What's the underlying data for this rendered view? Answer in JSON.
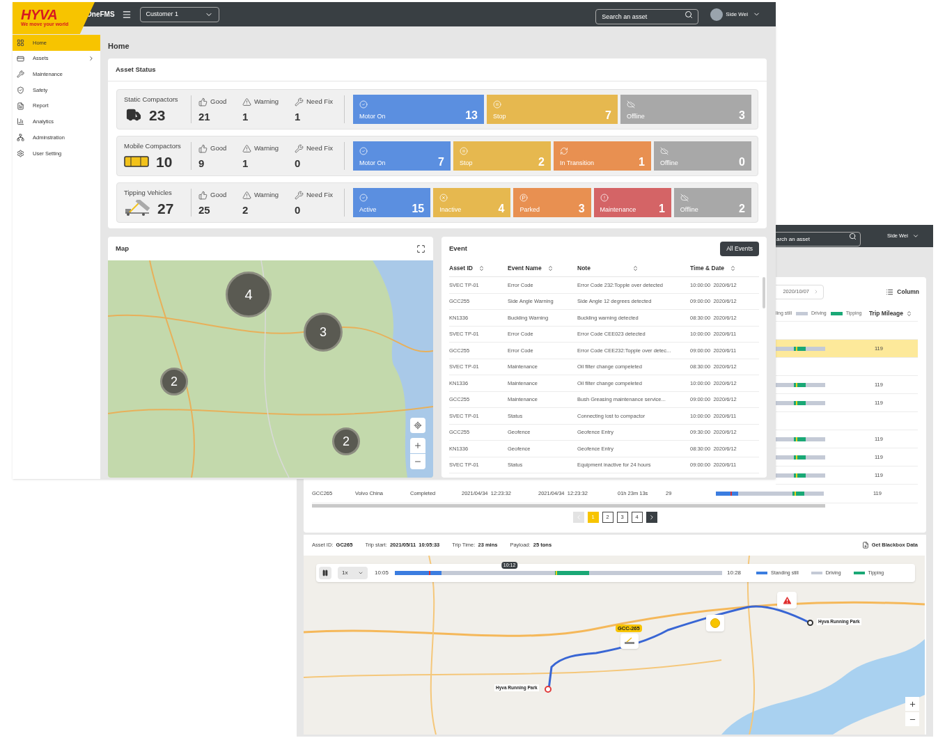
{
  "front": {
    "logo": {
      "brand": "HYVA",
      "tagline": "We move your world"
    },
    "header": {
      "app_name": "OneFMS",
      "customer_select": "Customer 1",
      "search_placeholder": "Search an asset",
      "user_name": "Side Wei"
    },
    "sidebar": {
      "items": [
        {
          "label": "Home",
          "selected": true,
          "has_submenu": false
        },
        {
          "label": "Assets",
          "selected": false,
          "has_submenu": true
        },
        {
          "label": "Maintenance",
          "selected": false,
          "has_submenu": false
        },
        {
          "label": "Safety",
          "selected": false,
          "has_submenu": false
        },
        {
          "label": "Report",
          "selected": false,
          "has_submenu": false
        },
        {
          "label": "Analytics",
          "selected": false,
          "has_submenu": false
        },
        {
          "label": "Adminstration",
          "selected": false,
          "has_submenu": false
        },
        {
          "label": "User Setting",
          "selected": false,
          "has_submenu": false
        }
      ]
    },
    "page_title": "Home",
    "asset_status": {
      "title": "Asset Status",
      "groups": [
        {
          "kind": "static",
          "name": "Static Compactors",
          "total": "23",
          "stats": [
            {
              "kind": "good",
              "label": "Good",
              "value": "21"
            },
            {
              "kind": "warning",
              "label": "Warning",
              "value": "1"
            },
            {
              "kind": "need_fix",
              "label": "Need Fix",
              "value": "1"
            }
          ],
          "tiles": [
            {
              "kind": "motor_on",
              "label": "Motor On",
              "count": "13"
            },
            {
              "kind": "stop",
              "label": "Stop",
              "count": "7"
            },
            {
              "kind": "offline",
              "label": "Offline",
              "count": "3"
            }
          ]
        },
        {
          "kind": "mobile",
          "name": "Mobile Compactors",
          "total": "10",
          "stats": [
            {
              "kind": "good",
              "label": "Good",
              "value": "9"
            },
            {
              "kind": "warning",
              "label": "Warning",
              "value": "1"
            },
            {
              "kind": "need_fix",
              "label": "Need Fix",
              "value": "0"
            }
          ],
          "tiles": [
            {
              "kind": "motor_on",
              "label": "Motor On",
              "count": "7"
            },
            {
              "kind": "stop",
              "label": "Stop",
              "count": "2"
            },
            {
              "kind": "transition",
              "label": "In Transition",
              "count": "1"
            },
            {
              "kind": "offline",
              "label": "Offline",
              "count": "0"
            }
          ]
        },
        {
          "kind": "tipping",
          "name": "Tipping Vehicles",
          "total": "27",
          "stats": [
            {
              "kind": "good",
              "label": "Good",
              "value": "25"
            },
            {
              "kind": "warning",
              "label": "Warning",
              "value": "2"
            },
            {
              "kind": "need_fix",
              "label": "Need Fix",
              "value": "0"
            }
          ],
          "tiles": [
            {
              "kind": "active",
              "label": "Active",
              "count": "15"
            },
            {
              "kind": "inactive",
              "label": "Inactive",
              "count": "4"
            },
            {
              "kind": "parked",
              "label": "Parked",
              "count": "3"
            },
            {
              "kind": "maintenance",
              "label": "Maintenance",
              "count": "1"
            },
            {
              "kind": "offline",
              "label": "Offline",
              "count": "2"
            }
          ]
        }
      ]
    },
    "map": {
      "title": "Map",
      "clusters": [
        {
          "count": "4"
        },
        {
          "count": "3"
        },
        {
          "count": "2"
        },
        {
          "count": "2"
        }
      ]
    },
    "events": {
      "title": "Event",
      "button": "All Events",
      "columns": [
        "Asset ID",
        "Event Name",
        "Note",
        "Time & Date"
      ],
      "rows": [
        {
          "asset_id": "SVEC TP-01",
          "event_name": "Error Code",
          "note": "Error Code 232:Topple over detected",
          "time": "10:00:00",
          "date": "2020/6/12"
        },
        {
          "asset_id": "GCC255",
          "event_name": "Side Angle Warning",
          "note": "Side Angle 12 degrees detected",
          "time": "09:00:00",
          "date": "2020/6/12"
        },
        {
          "asset_id": "KN1336",
          "event_name": "Buckling Warning",
          "note": "Buckling warning detected",
          "time": "08:30:00",
          "date": "2020/6/12"
        },
        {
          "asset_id": "SVEC TP-01",
          "event_name": "Error Code",
          "note": "Error Code CEE023 detected",
          "time": "10:00:00",
          "date": "2020/6/11"
        },
        {
          "asset_id": "GCC255",
          "event_name": "Error Code",
          "note": "Error Code CEE232:Topple over detec...",
          "time": "09:00:00",
          "date": "2020/6/11"
        },
        {
          "asset_id": "SVEC TP-01",
          "event_name": "Maintenance",
          "note": "Oil filter change compeleted",
          "time": "08:30:00",
          "date": "2020/6/12"
        },
        {
          "asset_id": "KN1336",
          "event_name": "Maintenance",
          "note": "Oil filter change compeleted",
          "time": "10:00:00",
          "date": "2020/6/12"
        },
        {
          "asset_id": "GCC255",
          "event_name": "Maintenance",
          "note": "Bush Greasing maintenance service...",
          "time": "09:00:00",
          "date": "2020/6/12"
        },
        {
          "asset_id": "SVEC TP-01",
          "event_name": "Status",
          "note": "Connecting lost to compactor",
          "time": "10:00:00",
          "date": "2020/6/11"
        },
        {
          "asset_id": "GCC255",
          "event_name": "Geofence",
          "note": "Geofence Entry",
          "time": "09:30:00",
          "date": "2020/6/12"
        },
        {
          "asset_id": "KN1336",
          "event_name": "Geofence",
          "note": "Geofence Entry",
          "time": "08:30:00",
          "date": "2020/6/12"
        },
        {
          "asset_id": "SVEC TP-01",
          "event_name": "Status",
          "note": "Equipment inactive for 24 hours",
          "time": "09:00:00",
          "date": "2020/6/11"
        }
      ]
    }
  },
  "back": {
    "header": {
      "search_placeholder": "arch an asset",
      "user_name": "Side Wei"
    },
    "trips": {
      "date": "2020/10/07",
      "column_button": "Column",
      "legend": [
        {
          "label": "ling still"
        },
        {
          "kind": "driving",
          "label": "Driving"
        },
        {
          "kind": "tipping",
          "label": "Tipping"
        }
      ],
      "mileage_header": "Trip Mileage",
      "rows": [
        {
          "kind": "group"
        },
        {
          "kind": "trip",
          "selected": true,
          "mileage": "119"
        },
        {
          "kind": "group"
        },
        {
          "kind": "trip",
          "selected": false,
          "mileage": "119"
        },
        {
          "kind": "trip",
          "selected": false,
          "mileage": "119"
        },
        {
          "kind": "group"
        },
        {
          "kind": "trip",
          "selected": false,
          "mileage": "119"
        },
        {
          "kind": "trip",
          "selected": false,
          "mileage": "119"
        },
        {
          "kind": "trip",
          "selected": false,
          "mileage": "119"
        },
        {
          "kind": "trip",
          "selected": false,
          "cells": [
            "GCC265",
            "Volvo China",
            "Completed",
            "2021/04/34  12:23:32",
            "2021/04/34  12:23:32",
            "01h 23m 13s",
            "29"
          ],
          "mileage": "119"
        }
      ],
      "pagination": {
        "prev_disabled": true,
        "pages": [
          {
            "label": "1",
            "selected": true
          },
          {
            "label": "2",
            "selected": false
          },
          {
            "label": "3",
            "selected": false
          },
          {
            "label": "4",
            "selected": false
          }
        ]
      }
    },
    "details": {
      "fields": [
        {
          "label": "Asset ID:",
          "value": "GC265"
        },
        {
          "label": "Trip start:",
          "value": "2021/05/11  10:05:33"
        },
        {
          "label": "Trip Time:",
          "value": "23 mins"
        },
        {
          "label": "Payload:",
          "value": "25 tons"
        }
      ],
      "blackbox_button": "Get Blackbox Data",
      "playback": {
        "speed": "1x",
        "start": "10:05",
        "end": "10:28",
        "current": "10:12",
        "level": 0.35,
        "legend": [
          {
            "kind": "standing",
            "label": "Standing still"
          },
          {
            "kind": "driving",
            "label": "Driving"
          },
          {
            "kind": "tipping",
            "label": "Tipping"
          }
        ]
      },
      "vehicle_label": "GCC-265",
      "places": [
        "Hyva Running Park",
        "Hyva Running Park"
      ]
    }
  }
}
